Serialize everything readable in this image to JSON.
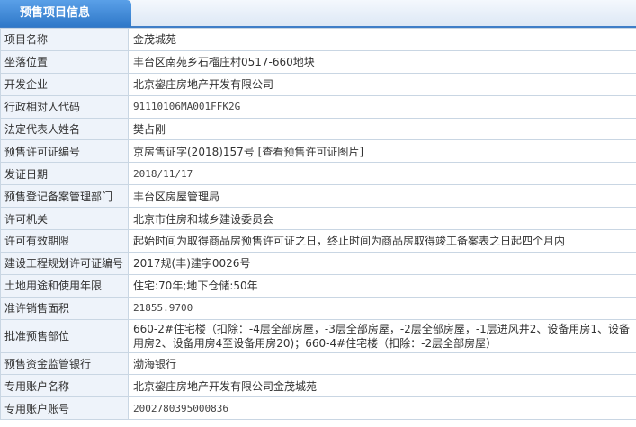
{
  "header": {
    "title": "预售项目信息"
  },
  "rows": [
    {
      "label": "项目名称",
      "value": "金茂城苑"
    },
    {
      "label": "坐落位置",
      "value": "丰台区南苑乡石榴庄村0517-660地块"
    },
    {
      "label": "开发企业",
      "value": "北京鋆庄房地产开发有限公司"
    },
    {
      "label": "行政相对人代码",
      "value": "91110106MA001FFK2G"
    },
    {
      "label": "法定代表人姓名",
      "value": "樊占刚"
    },
    {
      "label": "预售许可证编号",
      "value": "京房售证字(2018)157号",
      "link": "[查看预售许可证图片]"
    },
    {
      "label": "发证日期",
      "value": "2018/11/17"
    },
    {
      "label": "预售登记备案管理部门",
      "value": "丰台区房屋管理局"
    },
    {
      "label": "许可机关",
      "value": "北京市住房和城乡建设委员会"
    },
    {
      "label": "许可有效期限",
      "value": "起始时间为取得商品房预售许可证之日，终止时间为商品房取得竣工备案表之日起四个月内"
    },
    {
      "label": "建设工程规划许可证编号",
      "value": "2017规(丰)建字0026号"
    },
    {
      "label": "土地用途和使用年限",
      "value": "住宅:70年;地下仓储:50年"
    },
    {
      "label": "准许销售面积",
      "value": "21855.9700"
    },
    {
      "label": "批准预售部位",
      "value": "660-2#住宅楼（扣除：-4层全部房屋，-3层全部房屋，-2层全部房屋，-1层进风井2、设备用房1、设备用房2、设备用房4至设备用房20)；660-4#住宅楼（扣除：-2层全部房屋）"
    },
    {
      "label": "预售资金监管银行",
      "value": "渤海银行"
    },
    {
      "label": "专用账户名称",
      "value": "北京鋆庄房地产开发有限公司金茂城苑"
    },
    {
      "label": "专用账户账号",
      "value": "2002780395000836"
    }
  ],
  "colors": {
    "header_tab": "#2f78c8",
    "header_line": "#3f7ec7",
    "label_bg": "#eef3fa",
    "border": "#c9d6e3"
  }
}
